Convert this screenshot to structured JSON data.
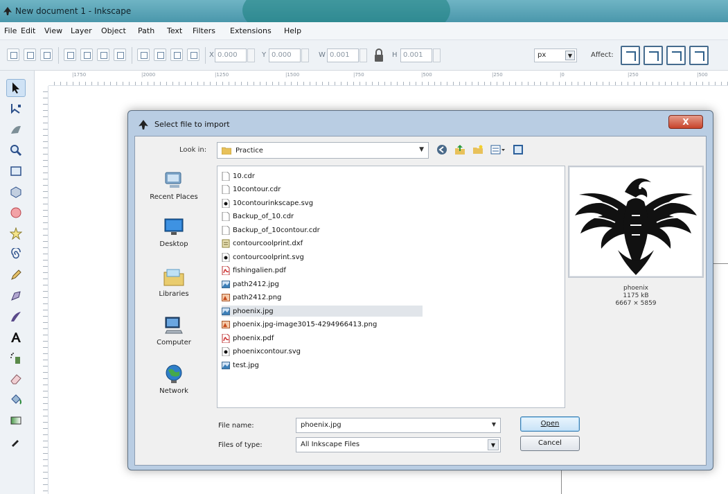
{
  "window": {
    "title": "New document 1 - Inkscape"
  },
  "menu": [
    "File",
    "Edit",
    "View",
    "Layer",
    "Object",
    "Path",
    "Text",
    "Filters",
    "Extensions",
    "Help"
  ],
  "toolbar": {
    "x_label": "X",
    "x_value": "0.000",
    "y_label": "Y",
    "y_value": "0.000",
    "w_label": "W",
    "w_value": "0.001",
    "h_label": "H",
    "h_value": "0.001",
    "unit": "px",
    "affect_label": "Affect:"
  },
  "ruler": {
    "labels": [
      "|1750",
      "|2000",
      "|1250",
      "|1500",
      "|750",
      "|500",
      "|250",
      "|0",
      "|250",
      "|500"
    ]
  },
  "dialog": {
    "title": "Select file to import",
    "close_label": "X",
    "look_in_label": "Look in:",
    "look_in_value": "Practice",
    "places": [
      "Recent Places",
      "Desktop",
      "Libraries",
      "Computer",
      "Network"
    ],
    "files": [
      {
        "name": "10.cdr",
        "type": "doc",
        "selected": false
      },
      {
        "name": "10contour.cdr",
        "type": "doc",
        "selected": false
      },
      {
        "name": "10contourinkscape.svg",
        "type": "svg",
        "selected": false
      },
      {
        "name": "Backup_of_10.cdr",
        "type": "doc",
        "selected": false
      },
      {
        "name": "Backup_of_10contour.cdr",
        "type": "doc",
        "selected": false
      },
      {
        "name": "contourcoolprint.dxf",
        "type": "dxf",
        "selected": false
      },
      {
        "name": "contourcoolprint.svg",
        "type": "svg",
        "selected": false
      },
      {
        "name": "fishingalien.pdf",
        "type": "pdf",
        "selected": false
      },
      {
        "name": "path2412.jpg",
        "type": "jpg",
        "selected": false
      },
      {
        "name": "path2412.png",
        "type": "png",
        "selected": false
      },
      {
        "name": "phoenix.jpg",
        "type": "jpg",
        "selected": true
      },
      {
        "name": "phoenix.jpg-image3015-4294966413.png",
        "type": "png",
        "selected": false
      },
      {
        "name": "phoenix.pdf",
        "type": "pdf",
        "selected": false
      },
      {
        "name": "phoenixcontour.svg",
        "type": "svg",
        "selected": false
      },
      {
        "name": "test.jpg",
        "type": "jpg",
        "selected": false
      }
    ],
    "preview": {
      "name": "phoenix",
      "size": "1175 kB",
      "dimensions": "6667 × 5859"
    },
    "file_name_label": "File name:",
    "file_name_value": "phoenix.jpg",
    "files_of_type_label": "Files of type:",
    "files_of_type_value": "All Inkscape Files",
    "open_label": "Open",
    "cancel_label": "Cancel"
  }
}
